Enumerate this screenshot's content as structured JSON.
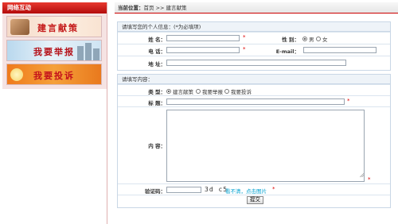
{
  "sidebar": {
    "header": "网络互动",
    "banners": [
      {
        "label": "建言献策"
      },
      {
        "label": "我要举报"
      },
      {
        "label": "我要投诉"
      }
    ]
  },
  "breadcrumb": {
    "prefix": "当前位置：",
    "path": "首页 >> 建言献策"
  },
  "personal": {
    "title": "请填写您的个人信息：(*为必填项)",
    "name_label": "姓 名：",
    "gender_label": "性 别：",
    "gender_options": [
      "男",
      "女"
    ],
    "phone_label": "电 话：",
    "email_label": "E-mail：",
    "address_label": "地 址："
  },
  "content": {
    "title": "请填写内容：",
    "type_label": "类 型：",
    "type_options": [
      "建言献策",
      "我要举报",
      "我要投诉"
    ],
    "subject_label": "标 题：",
    "body_label": "内 容：",
    "captcha_label": "验证码：",
    "captcha_text": "3d c5",
    "refresh_text": "看不清，点击图片",
    "submit_label": "提交"
  },
  "colors": {
    "accent": "#c00000",
    "panel_border": "#c9d7e6",
    "required": "#dd0000"
  }
}
